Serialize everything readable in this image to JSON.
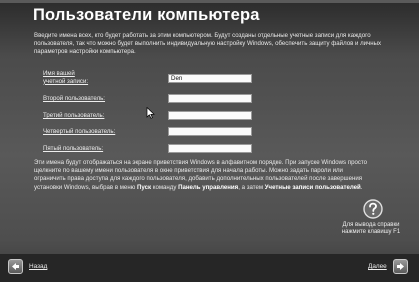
{
  "title": "Пользователи компьютера",
  "intro_text": "Введите имена всех, кто будет работать за этим компьютером. Будут созданы отдельные учетные записи для каждого пользователя, так что можно будет выполнить индивидуальную настройку Windows, обеспечить защиту файлов и личных параметров настройки компьютера.",
  "fields": [
    {
      "label_line1": "Имя вашей",
      "label_line2": "учетной записи:",
      "value": "Den"
    },
    {
      "label": "Второй пользователь:",
      "value": ""
    },
    {
      "label": "Третий пользователь:",
      "value": ""
    },
    {
      "label": "Четвертый пользователь:",
      "value": ""
    },
    {
      "label": "Пятый пользователь:",
      "value": ""
    }
  ],
  "note": {
    "part1": "Эти имена будут отображаться на экране приветствия Windows в алфавитном порядке. При запуске Windows просто щелкните по вашему имени пользователя в окне приветствия для начала работы. Можно задать пароли или ограничить права доступа для каждого пользователя, добавить дополнительных пользователей после завершения установки Windows, выбрав в меню ",
    "bold1": "Пуск",
    "part2": " команду ",
    "bold2": "Панель управления",
    "part3": ", а затем ",
    "bold3": "Учетные записи пользователей",
    "part4": "."
  },
  "help": {
    "icon": "question-icon",
    "line1": "Для вывода справки",
    "line2": "нажмите клавишу F1"
  },
  "nav": {
    "back_label": "Назад",
    "next_label": "Далее",
    "back_icon": "arrow-left-icon",
    "next_icon": "arrow-right-icon"
  },
  "colors": {
    "title": "#ffffff",
    "background": "#555555",
    "bottom_band": "#262626",
    "input_bg": "#fbfbfb"
  }
}
